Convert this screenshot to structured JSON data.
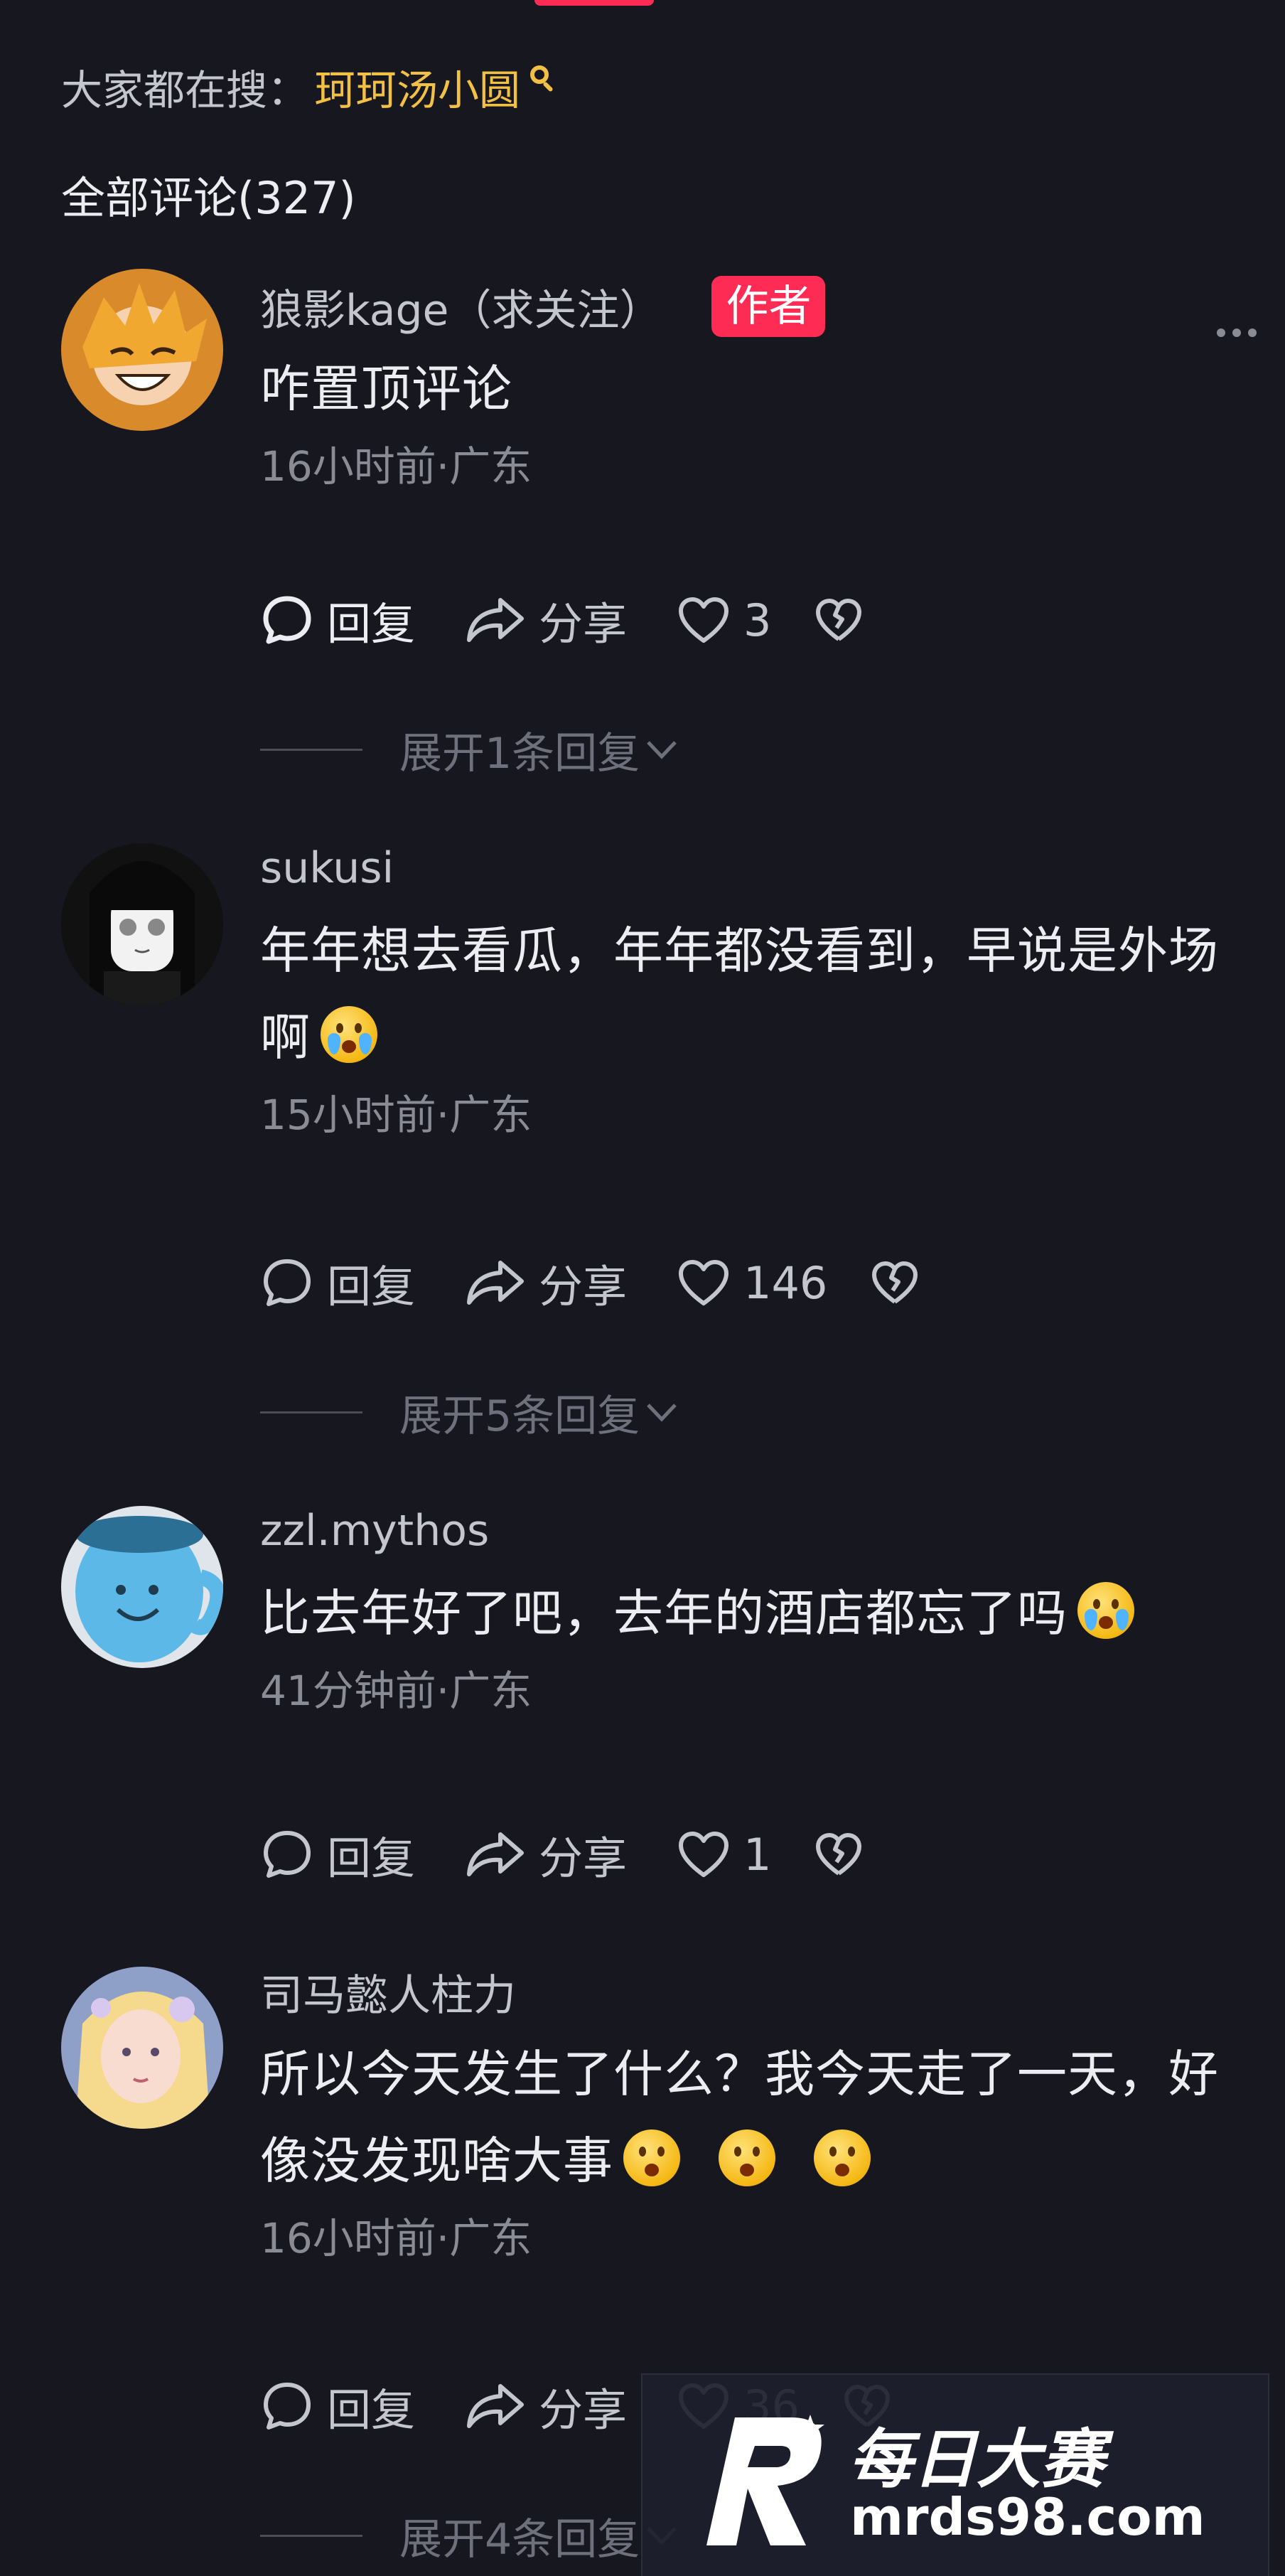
{
  "search": {
    "prefix": "大家都在搜：",
    "term": "珂珂汤小圆"
  },
  "comments_header": {
    "label": "全部评论(327)"
  },
  "comments": [
    {
      "username": "狼影kage（求关注）",
      "author_tag": "作者",
      "text": "咋置顶评论",
      "meta": "16小时前·广东",
      "actions": {
        "reply": "回复",
        "share": "分享",
        "likes": "3"
      },
      "expand": "展开1条回复"
    },
    {
      "username": "sukusi",
      "text": "年年想去看瓜，年年都没看到，早说是外场啊",
      "meta": "15小时前·广东",
      "actions": {
        "reply": "回复",
        "share": "分享",
        "likes": "146"
      },
      "expand": "展开5条回复"
    },
    {
      "username": "zzl.mythos",
      "text": "比去年好了吧，去年的酒店都忘了吗",
      "meta": "41分钟前·广东",
      "actions": {
        "reply": "回复",
        "share": "分享",
        "likes": "1"
      }
    },
    {
      "username": "司马懿人柱力",
      "text_line1": "所以今天发生了什么？我今天走了一天，好",
      "text_line2": "像没发现啥大事",
      "meta": "16小时前·广东",
      "actions": {
        "reply": "回复",
        "share": "分享",
        "likes": "36"
      },
      "expand": "展开4条回复"
    }
  ],
  "watermark": {
    "title": "每日大赛",
    "url": "mrds98.com"
  },
  "icons": {
    "search": "search-icon",
    "reply": "comment-bubble-icon",
    "share": "share-arrow-icon",
    "like": "heart-outline-icon",
    "dislike": "broken-heart-icon",
    "expand": "chevron-down-icon",
    "more": "more-dots-icon"
  },
  "colors": {
    "background": "#16171f",
    "accent_red": "#fe2c55",
    "search_term": "#f3c046"
  }
}
